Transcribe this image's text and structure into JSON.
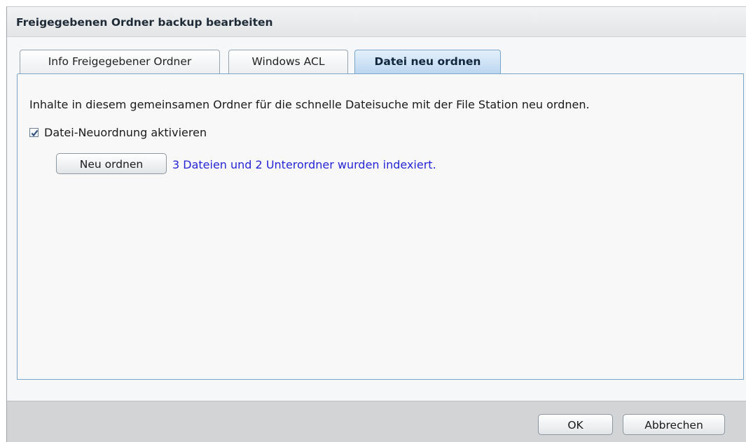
{
  "dialog": {
    "title": "Freigegebenen Ordner backup bearbeiten"
  },
  "tabs": [
    {
      "label": "Info Freigegebener Ordner",
      "active": false
    },
    {
      "label": "Windows ACL",
      "active": false
    },
    {
      "label": "Datei neu ordnen",
      "active": true
    }
  ],
  "panel": {
    "description": "Inhalte in diesem gemeinsamen Ordner für die schnelle Dateisuche mit der File Station neu ordnen.",
    "checkbox": {
      "label": "Datei-Neuordnung aktivieren",
      "checked": true
    },
    "reindex_button": "Neu ordnen",
    "status": "3 Dateien und 2 Unterordner wurden indexiert."
  },
  "footer": {
    "ok_label": "OK",
    "cancel_label": "Abbrechen"
  },
  "colors": {
    "status_text": "#2525d6",
    "active_tab": "#bcd7f0",
    "panel_border": "#7aa4c8",
    "footer_bg": "#d2d4d6"
  },
  "icons": {
    "checkbox": "checkmark-icon"
  }
}
